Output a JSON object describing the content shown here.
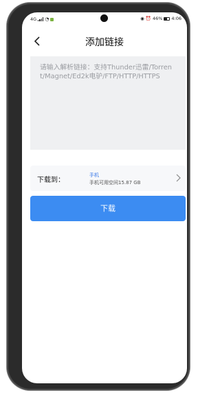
{
  "status_bar": {
    "left": "4G",
    "battery_percent": "46%",
    "time": "4:06"
  },
  "header": {
    "title": "添加链接"
  },
  "link_input": {
    "placeholder": "请输入解析链接：支持Thunder迅雷/Torrent/Magnet/Ed2k电驴/FTP/HTTP/HTTPS"
  },
  "download_location": {
    "label": "下载到：",
    "device": "手机",
    "free_space": "手机可用空间15.87 GB"
  },
  "download_button": {
    "label": "下载"
  },
  "colors": {
    "accent": "#3c8cf2",
    "link_blue": "#3a78e8",
    "input_bg": "#eff0f2",
    "placeholder": "#9a9ca1"
  }
}
